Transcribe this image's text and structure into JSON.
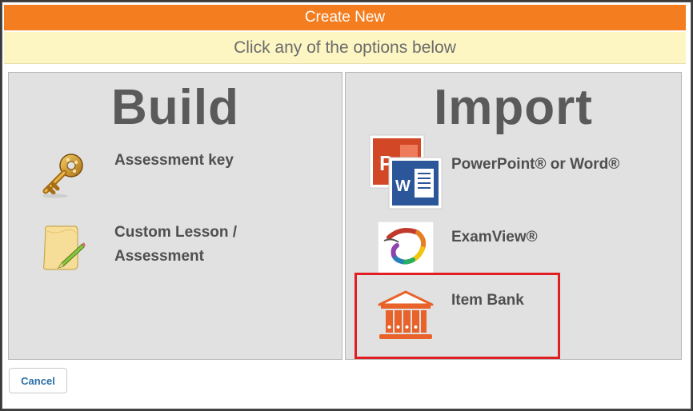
{
  "dialog": {
    "title": "Create New",
    "subtitle": "Click any of the options below",
    "accent_color": "#f47d20",
    "highlight_color": "#e01e24"
  },
  "build": {
    "heading": "Build",
    "options": [
      {
        "label": "Assessment key",
        "icon": "key-icon"
      },
      {
        "label_line1": "Custom Lesson /",
        "label_line2": "Assessment",
        "icon": "scroll-pencil-icon"
      }
    ]
  },
  "import": {
    "heading": "Import",
    "options": [
      {
        "label": "PowerPoint® or Word®",
        "icon": "powerpoint-word-icon"
      },
      {
        "label": "ExamView®",
        "icon": "examview-icon"
      },
      {
        "label": "Item Bank",
        "icon": "item-bank-icon",
        "highlighted": true
      }
    ]
  },
  "footer": {
    "cancel_label": "Cancel"
  }
}
